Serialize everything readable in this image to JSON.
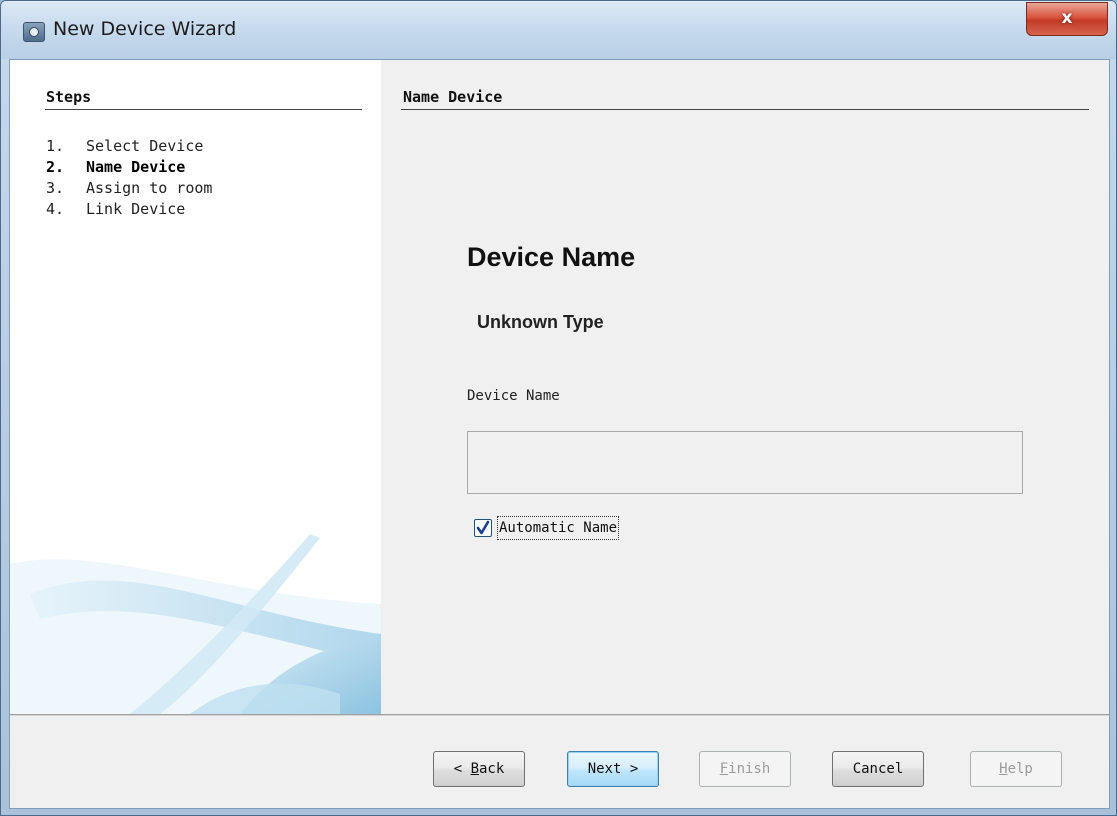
{
  "window": {
    "title": "New Device Wizard",
    "close_label": "x"
  },
  "steps": {
    "title": "Steps",
    "items": [
      {
        "num": "1.",
        "label": "Select Device"
      },
      {
        "num": "2.",
        "label": "Name Device"
      },
      {
        "num": "3.",
        "label": "Assign to room"
      },
      {
        "num": "4.",
        "label": "Link Device"
      }
    ],
    "active_index": 1
  },
  "page": {
    "header": "Name Device",
    "heading": "Device Name",
    "subheading": "Unknown Type",
    "field_label": "Device Name",
    "field_value": "",
    "automatic_name_label": "Automatic Name",
    "automatic_name_checked": true
  },
  "buttons": {
    "back": {
      "prefix": "< ",
      "mnemonic": "B",
      "rest": "ack"
    },
    "next": {
      "label": "Next >"
    },
    "finish": {
      "mnemonic": "F",
      "rest": "inish"
    },
    "cancel": {
      "label": "Cancel"
    },
    "help": {
      "mnemonic": "H",
      "rest": "elp"
    }
  },
  "colors": {
    "accent": "#3c7fb1",
    "close": "#d9543f"
  }
}
